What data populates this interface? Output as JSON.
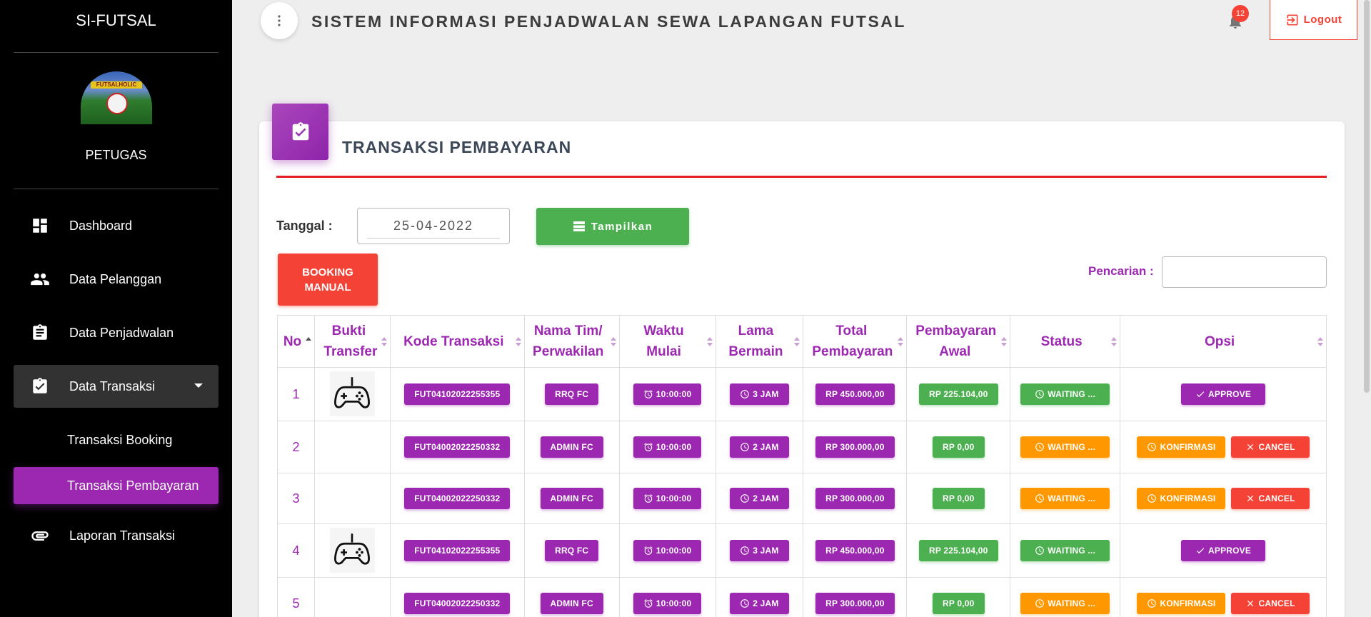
{
  "app": {
    "title": "SISTEM INFORMASI PENJADWALAN SEWA LAPANGAN FUTSAL",
    "notifications": "12",
    "logout_label": "Logout"
  },
  "sidebar": {
    "brand": "SI-FUTSAL",
    "avatar_text": "FUTSALHOLIC",
    "role": "PETUGAS",
    "items": [
      {
        "label": "Dashboard",
        "icon": "dashboard-icon"
      },
      {
        "label": "Data Pelanggan",
        "icon": "people-icon"
      },
      {
        "label": "Data Penjadwalan",
        "icon": "assignment-icon"
      },
      {
        "label": "Data Transaksi",
        "icon": "assignment-turned-in-icon"
      },
      {
        "label": "Transaksi Booking"
      },
      {
        "label": "Transaksi Pembayaran"
      },
      {
        "label": "Laporan Transaksi",
        "icon": "attachment-icon"
      }
    ]
  },
  "page": {
    "title": "TRANSAKSI PEMBAYARAN",
    "date_label": "Tanggal :",
    "date_value": "25-04-2022",
    "show_button": "Tampilkan",
    "booking_button": "BOOKING MANUAL",
    "search_label": "Pencarian :"
  },
  "table": {
    "headers": [
      "No",
      "Bukti Transfer",
      "Kode Transaksi",
      "Nama Tim/ Perwakilan",
      "Waktu Mulai",
      "Lama Bermain",
      "Total Pembayaran",
      "Pembayaran Awal",
      "Status",
      "Opsi"
    ],
    "rows": [
      {
        "no": "1",
        "has_proof": true,
        "kode": "FUT04102022255355",
        "tim": "RRQ FC",
        "waktu": "10:00:00",
        "lama": "3 JAM",
        "total": "RP 450.000,00",
        "awal": "RP 225.104,00",
        "status": "WAITING ...",
        "status_color": "green",
        "opsi": [
          "APPROVE"
        ]
      },
      {
        "no": "2",
        "has_proof": false,
        "kode": "FUT04002022250332",
        "tim": "ADMIN FC",
        "waktu": "10:00:00",
        "lama": "2 JAM",
        "total": "RP 300.000,00",
        "awal": "RP 0,00",
        "status": "WAITING ...",
        "status_color": "orange",
        "opsi": [
          "KONFIRMASI",
          "CANCEL"
        ]
      },
      {
        "no": "3",
        "has_proof": false,
        "kode": "FUT04002022250332",
        "tim": "ADMIN FC",
        "waktu": "10:00:00",
        "lama": "2 JAM",
        "total": "RP 300.000,00",
        "awal": "RP 0,00",
        "status": "WAITING ...",
        "status_color": "orange",
        "opsi": [
          "KONFIRMASI",
          "CANCEL"
        ]
      },
      {
        "no": "4",
        "has_proof": true,
        "kode": "FUT04102022255355",
        "tim": "RRQ FC",
        "waktu": "10:00:00",
        "lama": "3 JAM",
        "total": "RP 450.000,00",
        "awal": "RP 225.104,00",
        "status": "WAITING ...",
        "status_color": "green",
        "opsi": [
          "APPROVE"
        ]
      },
      {
        "no": "5",
        "has_proof": false,
        "kode": "FUT04002022250332",
        "tim": "ADMIN FC",
        "waktu": "10:00:00",
        "lama": "2 JAM",
        "total": "RP 300.000,00",
        "awal": "RP 0,00",
        "status": "WAITING ...",
        "status_color": "orange",
        "opsi": [
          "KONFIRMASI",
          "CANCEL"
        ]
      }
    ]
  },
  "colors": {
    "primary": "#9c27b0",
    "success": "#4caf50",
    "warning": "#ff9800",
    "danger": "#f44336"
  }
}
